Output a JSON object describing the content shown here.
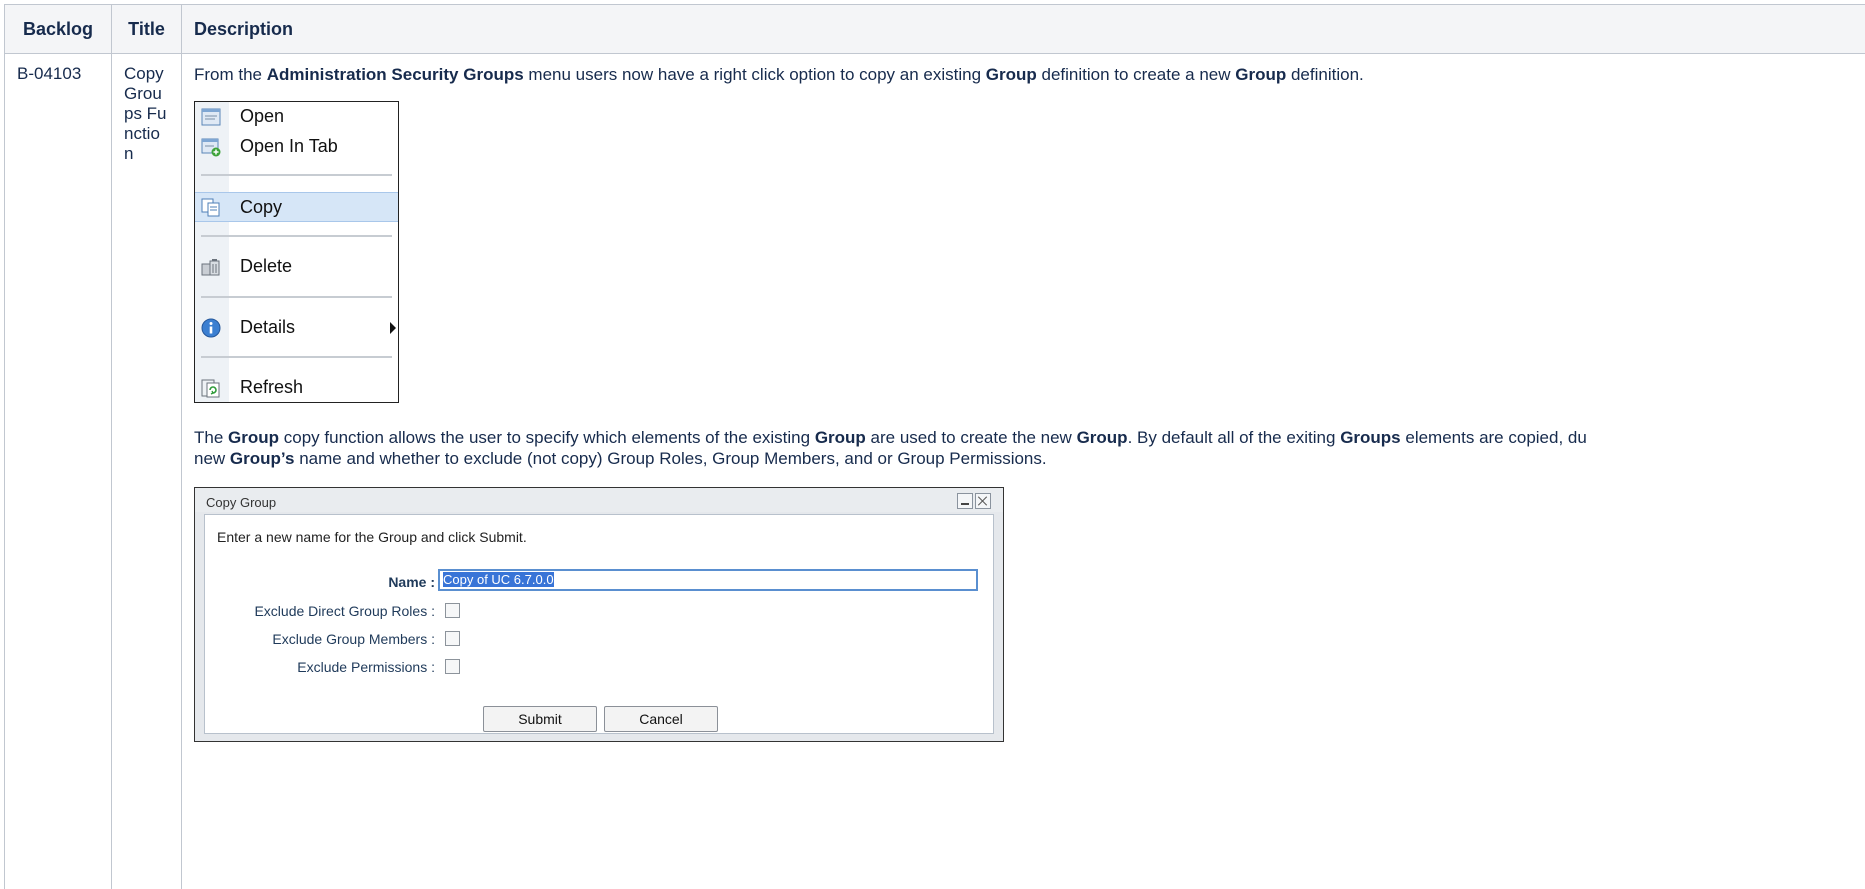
{
  "table": {
    "headers": {
      "backlog": "Backlog",
      "title": "Title",
      "description": "Description"
    },
    "row": {
      "backlog": "B-04103",
      "title": "Copy Groups Function"
    }
  },
  "para1": {
    "t1": "From the ",
    "b1": "Administration Security Groups",
    "t2": " menu users now have a right click option to copy an existing ",
    "b2": "Group",
    "t3": " definition to create a new ",
    "b3": "Group",
    "t4": " definition."
  },
  "context_menu": {
    "items": [
      {
        "label": "Open",
        "icon": "open-icon"
      },
      {
        "label": "Open In Tab",
        "icon": "open-in-tab-icon"
      },
      {
        "label": "Copy",
        "icon": "copy-icon",
        "highlighted": true
      },
      {
        "label": "Delete",
        "icon": "delete-icon"
      },
      {
        "label": "Details",
        "icon": "info-icon",
        "submenu": true
      },
      {
        "label": "Refresh",
        "icon": "refresh-icon"
      }
    ]
  },
  "para2": {
    "t1": "The ",
    "b1": "Group",
    "t2": " copy function allows the user to specify which elements of the existing ",
    "b2": "Group",
    "t3": " are used to create the new ",
    "b3": "Group",
    "t4": ". By default all of the exiting ",
    "b4": "Groups",
    "t5": " elements are copied, du",
    "l2t1": "new ",
    "l2b1": "Group’s",
    "l2t2": " name and whether to exclude (not copy) Group Roles, Group Members, and or Group Permissions."
  },
  "dialog": {
    "title": "Copy Group",
    "intro": "Enter a new name for the Group and click Submit.",
    "name_label": "Name :",
    "name_value": "Copy of UC 6.7.0.0",
    "exclude_roles_label": "Exclude Direct Group Roles :",
    "exclude_members_label": "Exclude Group Members :",
    "exclude_permissions_label": "Exclude Permissions :",
    "submit_label": "Submit",
    "cancel_label": "Cancel"
  }
}
